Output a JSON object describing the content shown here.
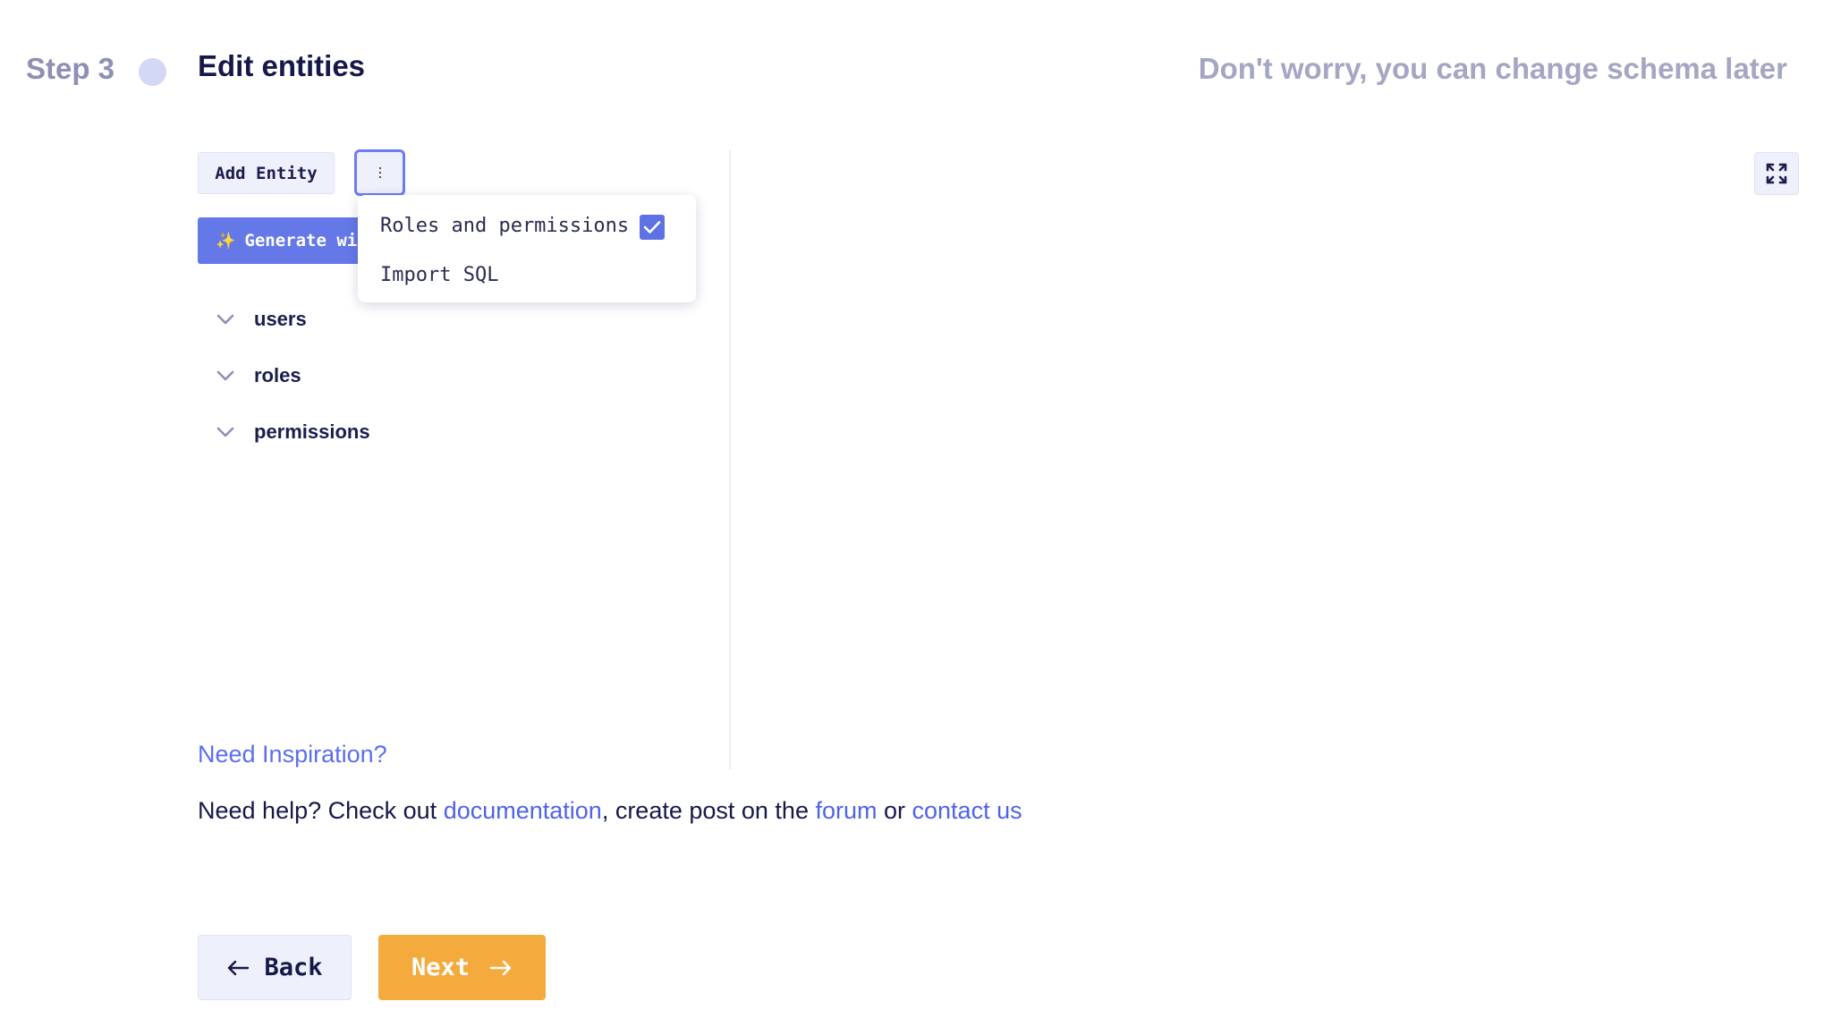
{
  "header": {
    "step_label": "Step 3",
    "title": "Edit entities",
    "subtitle": "Don't worry, you can change schema later"
  },
  "toolbar": {
    "add_entity_label": "Add Entity",
    "generate_label": "Generate wi",
    "more_icon": "vertical-ellipsis-icon"
  },
  "menu": {
    "items": [
      {
        "label": "Roles and permissions",
        "checked": true
      },
      {
        "label": "Import SQL"
      }
    ]
  },
  "entities": [
    {
      "name": "users"
    },
    {
      "name": "roles"
    },
    {
      "name": "permissions"
    }
  ],
  "inspiration_link": "Need Inspiration?",
  "help": {
    "prefix": "Need help? Check out ",
    "docs_link": "documentation",
    "middle": ", create post on the ",
    "forum_link": "forum",
    "or_text": " or ",
    "contact_link": "contact us"
  },
  "nav": {
    "back_label": "Back",
    "next_label": "Next"
  },
  "colors": {
    "accent": "#5e72e4",
    "next_button": "#f5aa3e",
    "link": "#4f63ea"
  }
}
